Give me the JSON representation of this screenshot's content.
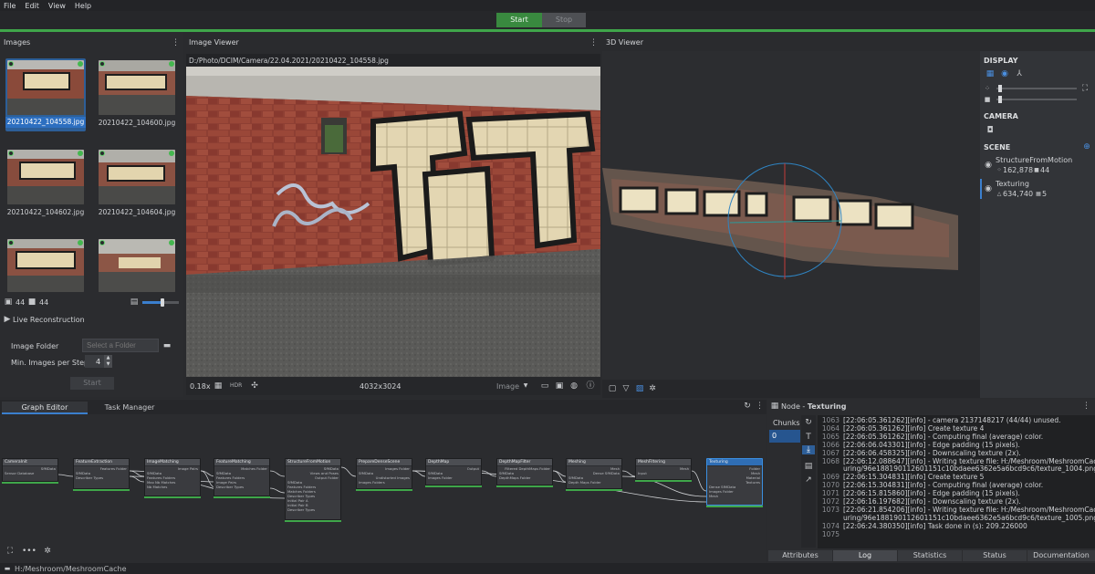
{
  "menu": [
    "File",
    "Edit",
    "View",
    "Help"
  ],
  "toolbar": {
    "start_label": "Start",
    "stop_label": "Stop"
  },
  "images_panel": {
    "title": "Images",
    "thumbnails": [
      {
        "label": "20210422_104558.jpg",
        "selected": true
      },
      {
        "label": "20210422_104600.jpg",
        "selected": false
      },
      {
        "label": "20210422_104602.jpg",
        "selected": false
      },
      {
        "label": "20210422_104604.jpg",
        "selected": false
      },
      {
        "label": "",
        "selected": false
      },
      {
        "label": "",
        "selected": false
      }
    ],
    "image_count": "44",
    "camera_count": "44",
    "live_reconstruction_label": "Live Reconstruction",
    "image_folder_label": "Image Folder",
    "image_folder_placeholder": "Select a Folder",
    "min_images_label": "Min. Images per Step",
    "min_images_value": "4",
    "start_label": "Start"
  },
  "image_viewer": {
    "title": "Image Viewer",
    "path": "D:/Photo/DCIM/Camera/22.04.2021/20210422_104558.jpg",
    "zoom": "0.18x",
    "hdr": "HDR",
    "resolution": "4032x3024",
    "mode": "Image"
  },
  "viewer3d": {
    "title": "3D Viewer",
    "display_label": "DISPLAY",
    "camera_label": "CAMERA",
    "scene_label": "SCENE",
    "scene_items": [
      {
        "name": "StructureFromMotion",
        "points": "162,878",
        "cameras": "44"
      },
      {
        "name": "Texturing",
        "triangles": "634,740",
        "textures": "5"
      }
    ]
  },
  "graph_editor": {
    "tabs": [
      "Graph Editor",
      "Task Manager"
    ],
    "nodes": [
      {
        "title": "CameraInit",
        "ports": [
          "SfMData",
          "Sensor Database"
        ]
      },
      {
        "title": "FeatureExtraction",
        "ports": [
          "Features Folder",
          "SfMData",
          "Describer Types"
        ]
      },
      {
        "title": "ImageMatching",
        "ports": [
          "Image Pairs",
          "SfMData",
          "Features Folders",
          "Max Nb Matches",
          "Nb Matches"
        ]
      },
      {
        "title": "FeatureMatching",
        "ports": [
          "Matches Folder",
          "SfMData",
          "Features Folders",
          "Image Pairs",
          "Describer Types"
        ]
      },
      {
        "title": "StructureFromMotion",
        "ports": [
          "SfMData",
          "Views and Poses",
          "Output Folder",
          "SfMData",
          "Features Folders",
          "Matches Folders",
          "Describer Types",
          "Initial Pair A",
          "Initial Pair B",
          "Describer Types"
        ]
      },
      {
        "title": "PrepareDenseScene",
        "ports": [
          "Images Folder",
          "SfMData",
          "Undistorted Images",
          "Images Folders"
        ]
      },
      {
        "title": "DepthMap",
        "ports": [
          "Output",
          "SfMData",
          "Images Folder"
        ]
      },
      {
        "title": "DepthMapFilter",
        "ports": [
          "Filtered DepthMaps Folder",
          "SfMData",
          "DepthMaps Folder"
        ]
      },
      {
        "title": "Meshing",
        "ports": [
          "Mesh",
          "Dense SfMData",
          "SfMData",
          "Depth Maps Folder"
        ]
      },
      {
        "title": "MeshFiltering",
        "ports": [
          "Mesh",
          "Input"
        ]
      },
      {
        "title": "Texturing",
        "ports": [
          "Folder",
          "Mesh",
          "Material",
          "Textures",
          "Dense SfMData",
          "Images Folder",
          "Mesh"
        ]
      }
    ]
  },
  "node_panel": {
    "title_prefix": "Node - ",
    "node_name": "Texturing",
    "chunks_label": "Chunks",
    "chunk_value": "0",
    "log_lines": [
      {
        "n": "1063",
        "t": "[22:06:05.361262][info] - camera 2137148217 (44/44) unused."
      },
      {
        "n": "1064",
        "t": "[22:06:05.361262][info] Create texture 4"
      },
      {
        "n": "1065",
        "t": "[22:06:05.361262][info]   - Computing final (average) color."
      },
      {
        "n": "1066",
        "t": "[22:06:06.043301][info]   - Edge padding (15 pixels)."
      },
      {
        "n": "1067",
        "t": "[22:06:06.458325][info]   - Downscaling texture (2x)."
      },
      {
        "n": "1068",
        "t": "[22:06:12.088647][info]   - Writing texture file: H:/Meshroom/MeshroomCache/Text"
      },
      {
        "n": "",
        "t": "uring/96e188190112601151c10bdaee6362e5a6bcd9c6/texture_1004.png"
      },
      {
        "n": "1069",
        "t": "[22:06:15.304831][info] Create texture 5"
      },
      {
        "n": "1070",
        "t": "[22:06:15.304831][info]   - Computing final (average) color."
      },
      {
        "n": "1071",
        "t": "[22:06:15.815860][info]   - Edge padding (15 pixels)."
      },
      {
        "n": "1072",
        "t": "[22:06:16.197682][info]   - Downscaling texture (2x)."
      },
      {
        "n": "1073",
        "t": "[22:06:21.854206][info]   - Writing texture file: H:/Meshroom/MeshroomCache/Text"
      },
      {
        "n": "",
        "t": "uring/96e188190112601151c10bdaee6362e5a6bcd9c6/texture_1005.png"
      },
      {
        "n": "1074",
        "t": "[22:06:24.380350][info] Task done in (s): 209.226000"
      },
      {
        "n": "1075",
        "t": ""
      }
    ],
    "bottom_tabs": [
      "Attributes",
      "Log",
      "Statistics",
      "Status",
      "Documentation"
    ]
  },
  "status_path": "H:/Meshroom/MeshroomCache"
}
